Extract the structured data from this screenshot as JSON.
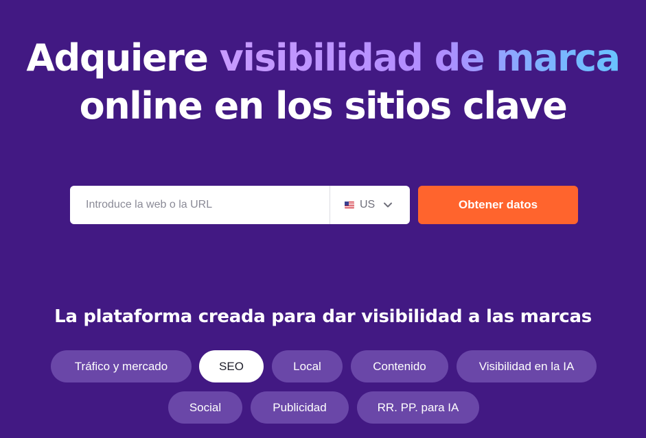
{
  "hero": {
    "title_part1": "Adquiere ",
    "title_accent": "visibilidad de marca",
    "title_part2": "online en los sitios clave"
  },
  "search": {
    "placeholder": "Introduce la web o la URL",
    "value": "",
    "database": {
      "flag_icon": "us-flag-icon",
      "code": "US"
    },
    "submit_label": "Obtener datos"
  },
  "platform": {
    "subtitle": "La plataforma creada para dar visibilidad a las marcas",
    "chips": [
      {
        "label": "Tráfico y mercado",
        "active": false
      },
      {
        "label": "SEO",
        "active": true
      },
      {
        "label": "Local",
        "active": false
      },
      {
        "label": "Contenido",
        "active": false
      },
      {
        "label": "Visibilidad en la IA",
        "active": false
      },
      {
        "label": "Social",
        "active": false
      },
      {
        "label": "Publicidad",
        "active": false
      },
      {
        "label": "RR. PP. para IA",
        "active": false
      }
    ]
  },
  "colors": {
    "background": "#421983",
    "accent_button": "#ff642d",
    "chip_inactive": "#6a47a8",
    "chip_active": "#ffffff"
  }
}
